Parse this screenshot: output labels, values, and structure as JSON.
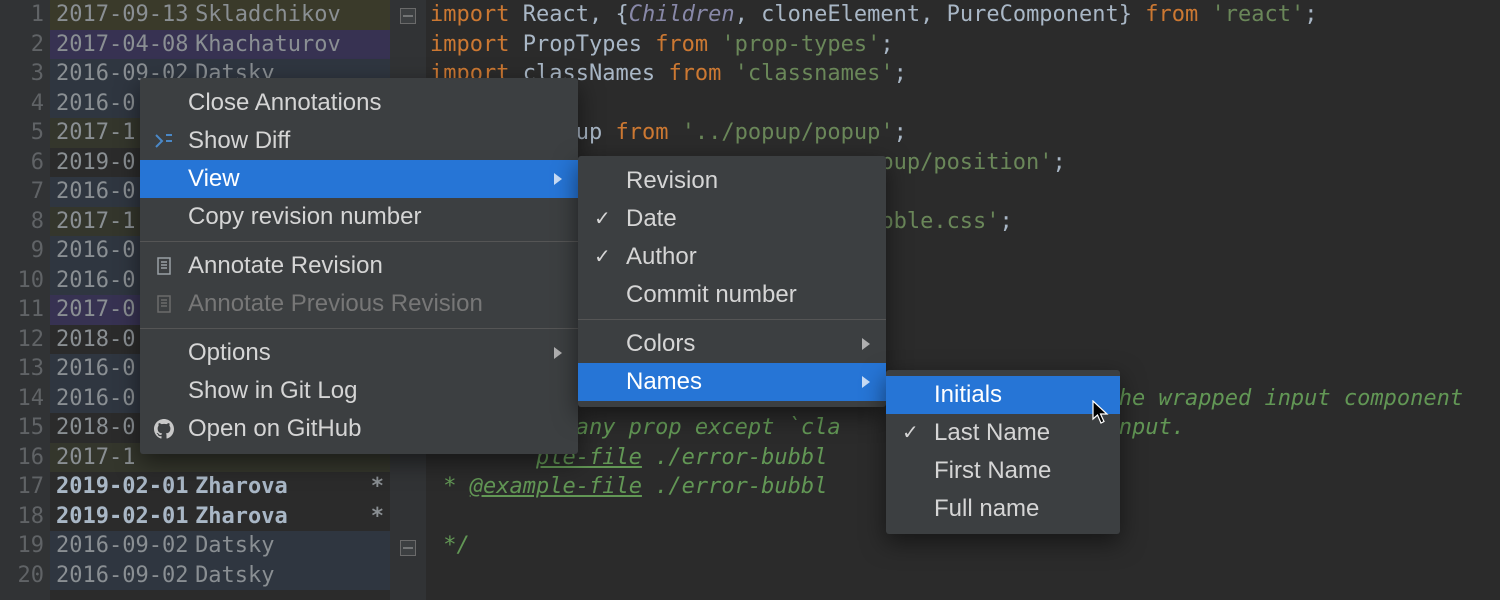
{
  "gutter": {
    "lines": [
      "1",
      "2",
      "3",
      "4",
      "5",
      "6",
      "7",
      "8",
      "9",
      "10",
      "11",
      "12",
      "13",
      "14",
      "15",
      "16",
      "17",
      "18",
      "19",
      "20"
    ]
  },
  "annotations": [
    {
      "date": "2017-09-13",
      "author": "Skladchikov",
      "bg": "ann-bg-a",
      "bold": false,
      "marker": ""
    },
    {
      "date": "2017-04-08",
      "author": "Khachaturov",
      "bg": "ann-bg-b",
      "bold": false,
      "marker": ""
    },
    {
      "date": "2016-09-02",
      "author": "Datsky",
      "bg": "ann-bg-c",
      "bold": false,
      "marker": ""
    },
    {
      "date": "2016-0",
      "author": "",
      "bg": "ann-bg-c",
      "bold": false,
      "marker": ""
    },
    {
      "date": "2017-1",
      "author": "",
      "bg": "ann-bg-d",
      "bold": false,
      "marker": ""
    },
    {
      "date": "2019-0",
      "author": "",
      "bg": "",
      "bold": false,
      "marker": ""
    },
    {
      "date": "2016-0",
      "author": "",
      "bg": "ann-bg-c",
      "bold": false,
      "marker": ""
    },
    {
      "date": "2017-1",
      "author": "",
      "bg": "ann-bg-d",
      "bold": false,
      "marker": ""
    },
    {
      "date": "2016-0",
      "author": "",
      "bg": "ann-bg-c",
      "bold": false,
      "marker": ""
    },
    {
      "date": "2016-0",
      "author": "",
      "bg": "ann-bg-c",
      "bold": false,
      "marker": ""
    },
    {
      "date": "2017-0",
      "author": "",
      "bg": "ann-bg-b",
      "bold": false,
      "marker": ""
    },
    {
      "date": "2018-0",
      "author": "",
      "bg": "",
      "bold": false,
      "marker": ""
    },
    {
      "date": "2016-0",
      "author": "",
      "bg": "ann-bg-c",
      "bold": false,
      "marker": ""
    },
    {
      "date": "2016-0",
      "author": "",
      "bg": "ann-bg-c",
      "bold": false,
      "marker": ""
    },
    {
      "date": "2018-0",
      "author": "",
      "bg": "",
      "bold": false,
      "marker": ""
    },
    {
      "date": "2017-1",
      "author": "",
      "bg": "ann-bg-d",
      "bold": false,
      "marker": ""
    },
    {
      "date": "2019-02-01",
      "author": "Zharova",
      "bg": "",
      "bold": true,
      "marker": "*"
    },
    {
      "date": "2019-02-01",
      "author": "Zharova",
      "bg": "",
      "bold": true,
      "marker": "*"
    },
    {
      "date": "2016-09-02",
      "author": "Datsky",
      "bg": "ann-bg-c",
      "bold": false,
      "marker": ""
    },
    {
      "date": "2016-09-02",
      "author": "Datsky",
      "bg": "ann-bg-c",
      "bold": false,
      "marker": ""
    }
  ],
  "code": {
    "l1": {
      "kw1": "import",
      "p1": " React, {",
      "it": "Children",
      "p2": ", cloneElement, PureComponent} ",
      "kw2": "from ",
      "str": "'react'",
      "p3": ";"
    },
    "l2": {
      "kw1": "import",
      "p1": " PropTypes ",
      "kw2": "from ",
      "str": "'prop-types'",
      "p3": ";"
    },
    "l3": {
      "kw1": "import",
      "p1": " classNames ",
      "kw2": "from ",
      "str": "'classnames'",
      "p3": ";"
    },
    "l5": {
      "p1": "opup ",
      "kw2": "from ",
      "str": "'../popup/popup'",
      "p3": ";"
    },
    "l6": {
      "p1": "",
      "str": "opup/position'",
      "p3": ";"
    },
    "l8": {
      "p1": "",
      "str": "ubble.css'",
      "p3": ";"
    },
    "l14": {
      "cm": "he wrapped input component"
    },
    "l15": {
      "cm1": "es any prop except `cla",
      "cm2": "he input."
    },
    "l16": {
      "tg": "ple-file",
      "cm": " ./error-bubbl"
    },
    "l17": {
      "pre": " * ",
      "tg": "@example-file",
      "cm": " ./error-bubbl"
    },
    "l19": {
      "cm": " */"
    }
  },
  "menu1": {
    "close_annotations": "Close Annotations",
    "show_diff": "Show Diff",
    "view": "View",
    "copy_revision": "Copy revision number",
    "annotate_rev": "Annotate Revision",
    "annotate_prev": "Annotate Previous Revision",
    "options": "Options",
    "show_git_log": "Show in Git Log",
    "open_github": "Open on GitHub"
  },
  "menu2": {
    "revision": "Revision",
    "date": "Date",
    "author": "Author",
    "commit_number": "Commit number",
    "colors": "Colors",
    "names": "Names"
  },
  "menu3": {
    "initials": "Initials",
    "last_name": "Last Name",
    "first_name": "First Name",
    "full_name": "Full name"
  }
}
